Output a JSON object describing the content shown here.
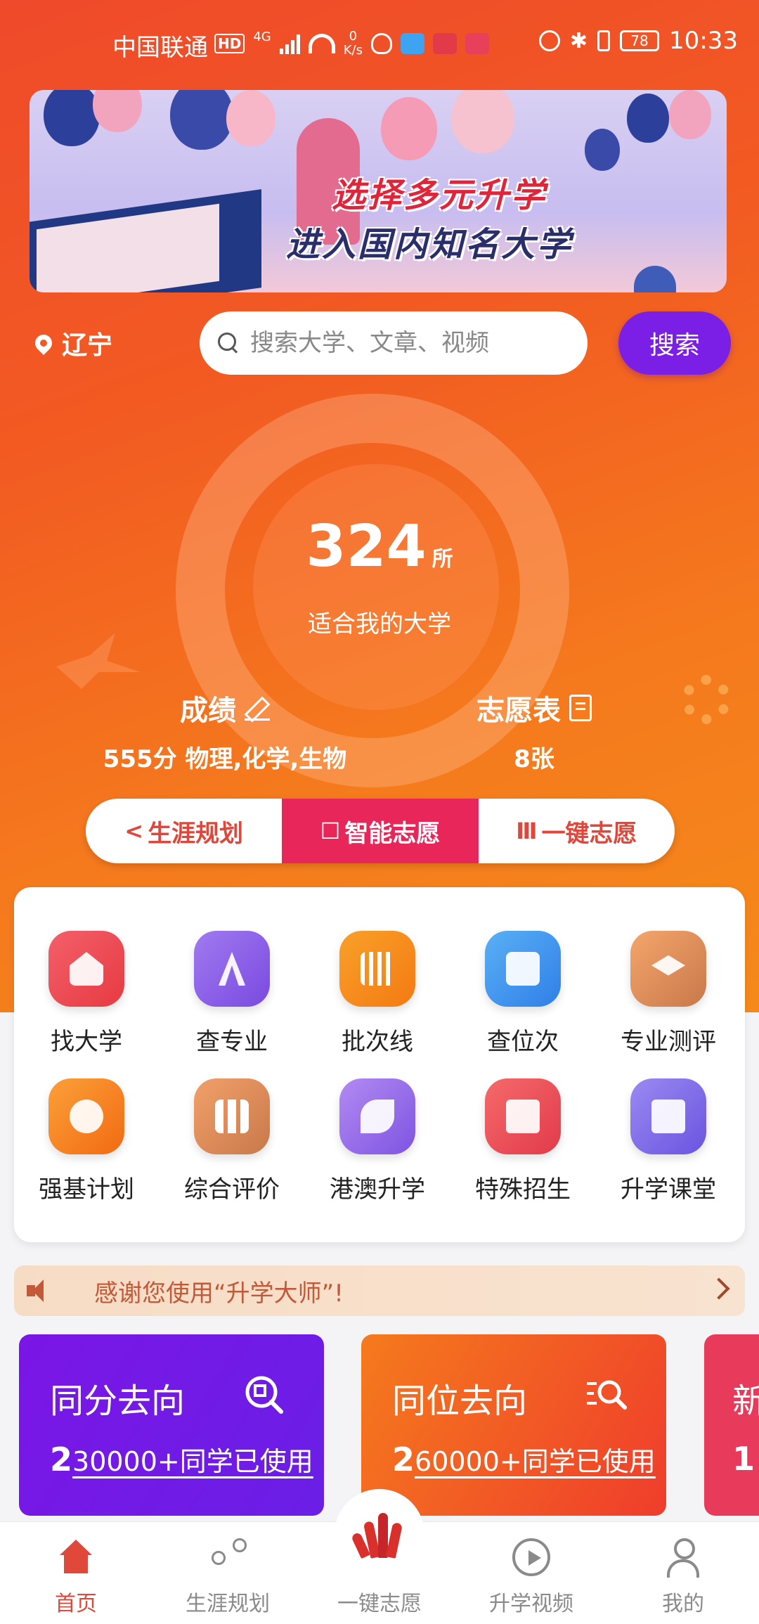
{
  "status_bar": {
    "carrier": "中国联通",
    "hd": "HD",
    "network": "4G",
    "speed_value": "0",
    "speed_unit": "K/s",
    "battery": "78",
    "time": "10:33"
  },
  "banner": {
    "line1": "选择多元升学",
    "line2": "进入国内知名大学"
  },
  "location": {
    "province": "辽宁"
  },
  "search": {
    "placeholder": "搜索大学、文章、视频",
    "value": "",
    "button_label": "搜索"
  },
  "summary": {
    "count": "324",
    "unit": "所",
    "label": "适合我的大学"
  },
  "score": {
    "title": "成绩",
    "value": "555分 物理,化学,生物"
  },
  "wishlist": {
    "title": "志愿表",
    "value": "8张"
  },
  "segments": [
    {
      "icon": "share-icon",
      "label": "生涯规划"
    },
    {
      "icon": "edit-icon",
      "label": "智能志愿",
      "active": true
    },
    {
      "icon": "bars-icon",
      "label": "一键志愿"
    }
  ],
  "grid": [
    {
      "label": "找大学",
      "icon": "school-icon",
      "color": "#ea4a4a"
    },
    {
      "label": "查专业",
      "icon": "compass-icon",
      "color": "#8a5ae6"
    },
    {
      "label": "批次线",
      "icon": "batch-line-icon",
      "color": "#f58a1a"
    },
    {
      "label": "查位次",
      "icon": "scroll-icon",
      "color": "#3e8ef0"
    },
    {
      "label": "专业测评",
      "icon": "graduation-cap-icon",
      "color": "#e8945c"
    },
    {
      "label": "强基计划",
      "icon": "medal-icon",
      "color": "#f5861f"
    },
    {
      "label": "综合评价",
      "icon": "books-icon",
      "color": "#e58a4a"
    },
    {
      "label": "港澳升学",
      "icon": "sprout-icon",
      "color": "#9b6ae8"
    },
    {
      "label": "特殊招生",
      "icon": "message-icon",
      "color": "#ea4a52"
    },
    {
      "label": "升学课堂",
      "icon": "video-icon",
      "color": "#7a6ae8"
    }
  ],
  "notice": {
    "text": "感谢您使用“升学大师”!"
  },
  "features": [
    {
      "title": "同分去向",
      "big": "2",
      "rest": "30000+同学已使用",
      "icon": "search-doc-icon"
    },
    {
      "title": "同位去向",
      "big": "2",
      "rest": "60000+同学已使用",
      "icon": "list-search-icon"
    },
    {
      "title": "新",
      "big": "1",
      "rest": ""
    }
  ],
  "nav": [
    {
      "label": "首页",
      "icon": "home-icon",
      "active": true
    },
    {
      "label": "生涯规划",
      "icon": "share-icon"
    },
    {
      "label": "一键志愿",
      "icon": "app-logo-icon"
    },
    {
      "label": "升学视频",
      "icon": "play-icon"
    },
    {
      "label": "我的",
      "icon": "user-icon"
    }
  ],
  "colors": {
    "accent_purple": "#7b1ee6",
    "accent_red": "#e8265a",
    "nav_active": "#e0483a"
  }
}
